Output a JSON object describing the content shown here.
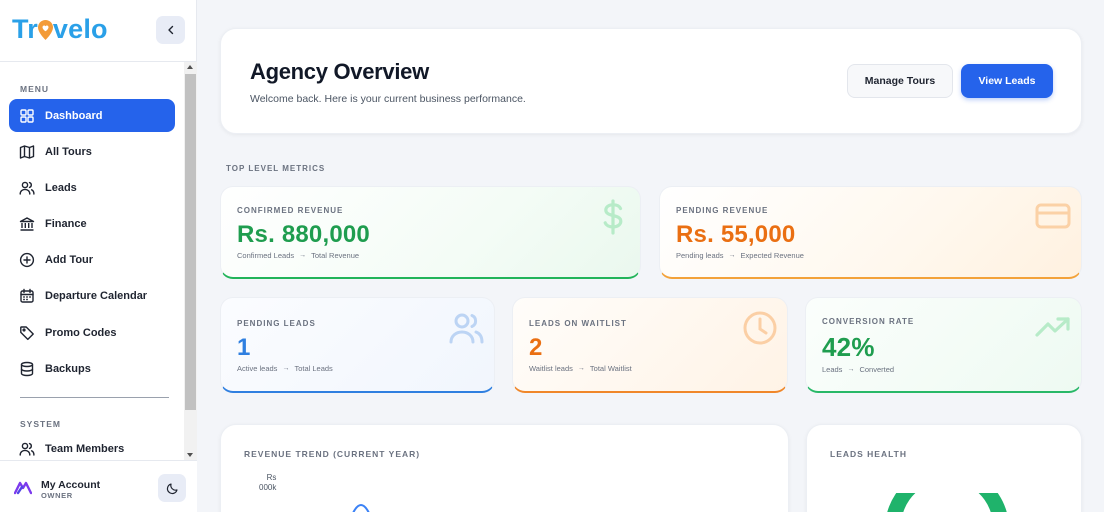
{
  "brand": {
    "name_pre": "Tr",
    "name_pin": "♥",
    "name_post": "velo"
  },
  "sidebar": {
    "menu_label": "MENU",
    "system_label": "SYSTEM",
    "items": [
      {
        "label": "Dashboard",
        "icon": "dashboard-icon",
        "active": true
      },
      {
        "label": "All Tours",
        "icon": "map-icon"
      },
      {
        "label": "Leads",
        "icon": "users-icon"
      },
      {
        "label": "Finance",
        "icon": "bank-icon"
      },
      {
        "label": "Add Tour",
        "icon": "plus-circle-icon"
      },
      {
        "label": "Departure Calendar",
        "icon": "calendar-icon"
      },
      {
        "label": "Promo Codes",
        "icon": "tag-icon"
      },
      {
        "label": "Backups",
        "icon": "database-icon"
      }
    ],
    "system_items": [
      {
        "label": "Team Members",
        "icon": "users-icon"
      }
    ]
  },
  "account": {
    "name": "My Account",
    "role": "OWNER"
  },
  "header": {
    "title": "Agency Overview",
    "subtitle": "Welcome back. Here is your current business performance.",
    "manage_label": "Manage Tours",
    "view_label": "View Leads"
  },
  "metrics": {
    "section_label": "TOP LEVEL METRICS",
    "confirmed": {
      "label": "CONFIRMED REVENUE",
      "value": "Rs. 880,000",
      "from": "Confirmed Leads",
      "to": "Total Revenue",
      "color": "#1f9d4f"
    },
    "pending_revenue": {
      "label": "PENDING REVENUE",
      "value": "Rs. 55,000",
      "from": "Pending leads",
      "to": "Expected Revenue",
      "color": "#ea6f12"
    },
    "pending_leads": {
      "label": "PENDING LEADS",
      "value": "1",
      "from": "Active leads",
      "to": "Total Leads",
      "color": "#2f7fe0"
    },
    "waitlist": {
      "label": "LEADS ON WAITLIST",
      "value": "2",
      "from": "Waitlist leads",
      "to": "Total Waitlist",
      "color": "#ea6f12"
    },
    "conversion": {
      "label": "CONVERSION RATE",
      "value": "42%",
      "from": "Leads",
      "to": "Converted",
      "color": "#1f9d4f"
    }
  },
  "panels": {
    "trend_title": "REVENUE TREND (CURRENT YEAR)",
    "trend_unit_top": "Rs",
    "trend_unit_bottom": "000k",
    "health_title": "LEADS HEALTH"
  },
  "arrow_glyph": "→"
}
